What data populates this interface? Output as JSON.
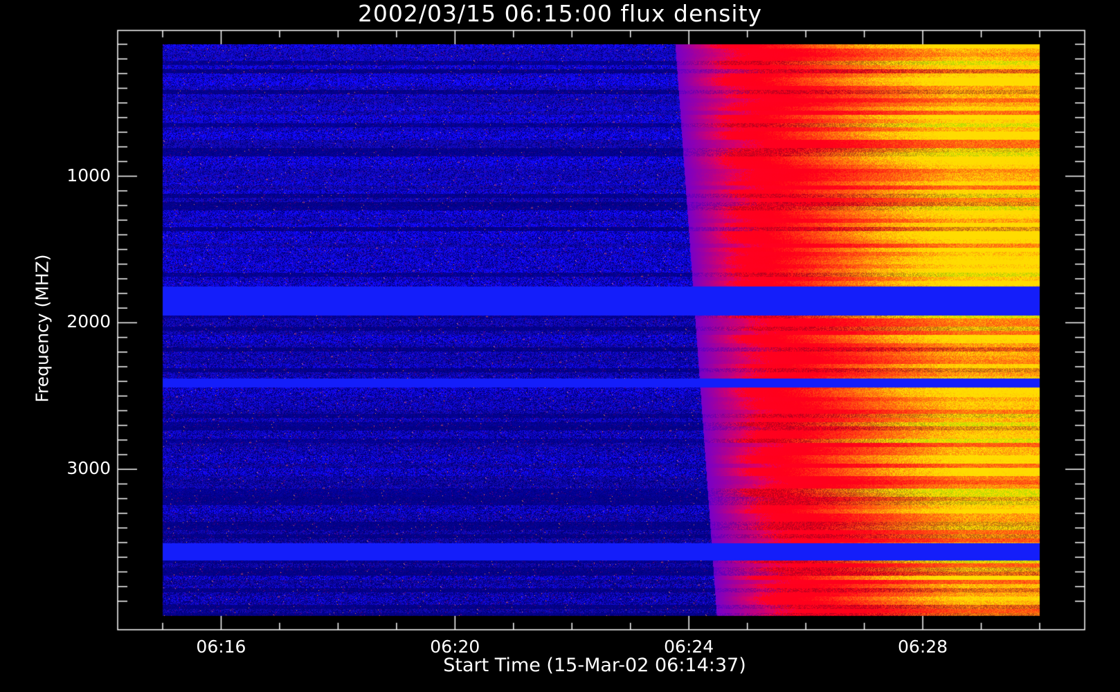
{
  "chart_data": {
    "type": "heatmap",
    "title": "2002/03/15 06:15:00 flux density",
    "xlabel": "Start Time (15-Mar-02 06:14:37)",
    "ylabel": "Frequency (MHZ)",
    "x_range": [
      "06:15:00",
      "06:30:00"
    ],
    "y_range": [
      100,
      4000
    ],
    "y_inverted": true,
    "x_ticks": [
      "06:16",
      "06:20",
      "06:24",
      "06:28"
    ],
    "y_ticks": [
      1000,
      2000,
      3000
    ],
    "colors": {
      "background": "#000000",
      "low": "#1414ff",
      "high": "#ff2000",
      "peak": "#ffd000"
    },
    "burst_onset": "06:24"
  }
}
